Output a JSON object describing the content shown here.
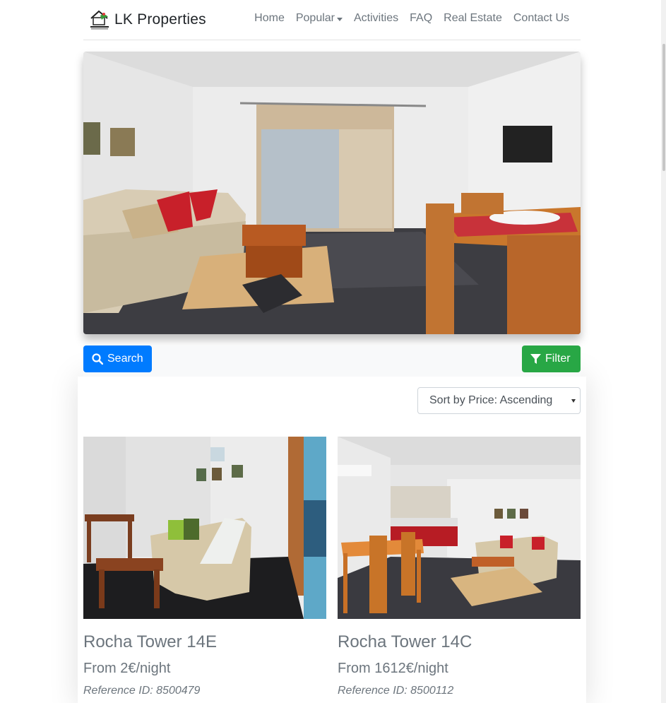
{
  "brand": {
    "name": "LK Properties",
    "logo_icon": "house-logo-icon"
  },
  "nav": {
    "items": [
      {
        "label": "Home"
      },
      {
        "label": "Popular",
        "dropdown": true
      },
      {
        "label": "Activities"
      },
      {
        "label": "FAQ"
      },
      {
        "label": "Real Estate"
      },
      {
        "label": "Contact Us"
      }
    ]
  },
  "toolbar": {
    "search_label": "Search",
    "search_icon": "search-icon",
    "filter_label": "Filter",
    "filter_icon": "filter-icon",
    "search_color": "#007bff",
    "filter_color": "#28a745"
  },
  "sort": {
    "selected": "Sort by Price: Ascending"
  },
  "listings": [
    {
      "title": "Rocha Tower 14E",
      "price": "From 2€/night",
      "reference": "Reference ID: 8500479"
    },
    {
      "title": "Rocha Tower 14C",
      "price": "From 1612€/night",
      "reference": "Reference ID: 8500112"
    }
  ]
}
